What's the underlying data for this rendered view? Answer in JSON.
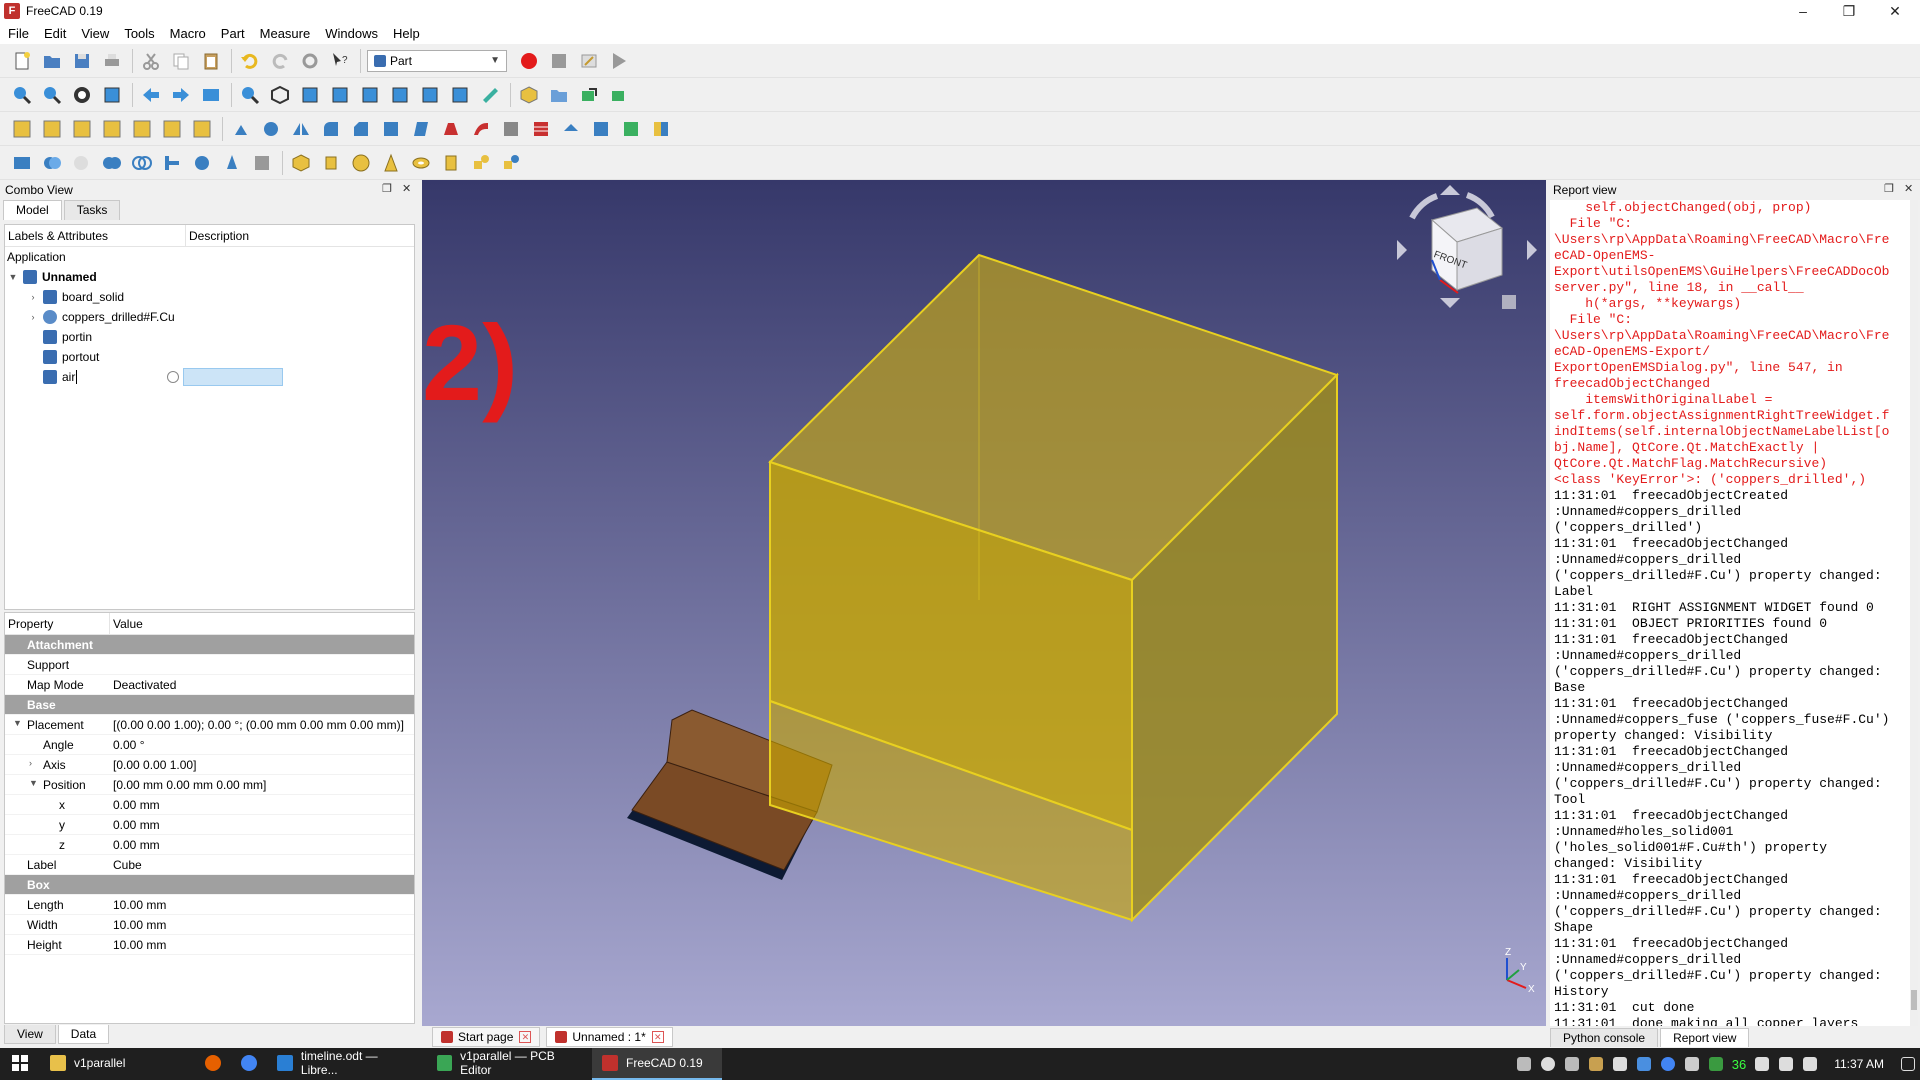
{
  "window": {
    "title": "FreeCAD 0.19",
    "minimize": "–",
    "maximize": "❐",
    "close": "✕"
  },
  "menu": [
    "File",
    "Edit",
    "View",
    "Tools",
    "Macro",
    "Part",
    "Measure",
    "Windows",
    "Help"
  ],
  "toolbar": {
    "workbench": "Part"
  },
  "combo_view": {
    "title": "Combo View",
    "tabs": [
      "Model",
      "Tasks"
    ],
    "tree_headers": [
      "Labels & Attributes",
      "Description"
    ],
    "root_label": "Application",
    "document": "Unnamed",
    "items": [
      {
        "label": "board_solid",
        "expandable": true
      },
      {
        "label": "coppers_drilled#F.Cu",
        "expandable": true
      },
      {
        "label": "portin",
        "expandable": false
      },
      {
        "label": "portout",
        "expandable": false
      },
      {
        "label": "air",
        "expandable": false
      }
    ]
  },
  "properties": {
    "headers": [
      "Property",
      "Value"
    ],
    "rows": [
      {
        "group": "Attachment"
      },
      {
        "name": "Support",
        "value": "",
        "indent": 0
      },
      {
        "name": "Map Mode",
        "value": "Deactivated",
        "indent": 0
      },
      {
        "group": "Base"
      },
      {
        "name": "Placement",
        "value": "[(0.00 0.00 1.00); 0.00 °; (0.00 mm  0.00 mm  0.00 mm)]",
        "indent": 0,
        "expand": "open"
      },
      {
        "name": "Angle",
        "value": "0.00 °",
        "indent": 1
      },
      {
        "name": "Axis",
        "value": "[0.00 0.00 1.00]",
        "indent": 1,
        "expand": "closed"
      },
      {
        "name": "Position",
        "value": "[0.00 mm  0.00 mm  0.00 mm]",
        "indent": 1,
        "expand": "open"
      },
      {
        "name": "x",
        "value": "0.00 mm",
        "indent": 2
      },
      {
        "name": "y",
        "value": "0.00 mm",
        "indent": 2
      },
      {
        "name": "z",
        "value": "0.00 mm",
        "indent": 2
      },
      {
        "name": "Label",
        "value": "Cube",
        "indent": 0
      },
      {
        "group": "Box"
      },
      {
        "name": "Length",
        "value": "10.00 mm",
        "indent": 0
      },
      {
        "name": "Width",
        "value": "10.00 mm",
        "indent": 0
      },
      {
        "name": "Height",
        "value": "10.00 mm",
        "indent": 0
      }
    ],
    "bottom_tabs": [
      "View",
      "Data"
    ]
  },
  "viewport": {
    "annotation": "2)",
    "navcube_face": "FRONT",
    "axis_labels": [
      "Z",
      "Y",
      "X"
    ],
    "box_color": "#c9a700"
  },
  "doc_tabs": [
    "Start page",
    "Unnamed : 1*"
  ],
  "report_view": {
    "title": "Report view",
    "lines": [
      {
        "t": "    self.objectChanged(obj, prop)",
        "err": true
      },
      {
        "t": "  File \"C:",
        "err": true
      },
      {
        "t": "\\Users\\rp\\AppData\\Roaming\\FreeCAD\\Macro\\Fre",
        "err": true
      },
      {
        "t": "eCAD-OpenEMS-",
        "err": true
      },
      {
        "t": "Export\\utilsOpenEMS\\GuiHelpers\\FreeCADDocOb",
        "err": true
      },
      {
        "t": "server.py\", line 18, in __call__",
        "err": true
      },
      {
        "t": "    h(*args, **keywargs)",
        "err": true
      },
      {
        "t": "  File \"C:",
        "err": true
      },
      {
        "t": "\\Users\\rp\\AppData\\Roaming\\FreeCAD\\Macro\\Fre",
        "err": true
      },
      {
        "t": "eCAD-OpenEMS-Export/",
        "err": true
      },
      {
        "t": "ExportOpenEMSDialog.py\", line 547, in",
        "err": true
      },
      {
        "t": "freecadObjectChanged",
        "err": true
      },
      {
        "t": "    itemsWithOriginalLabel =",
        "err": true
      },
      {
        "t": "self.form.objectAssignmentRightTreeWidget.f",
        "err": true
      },
      {
        "t": "indItems(self.internalObjectNameLabelList[o",
        "err": true
      },
      {
        "t": "bj.Name], QtCore.Qt.MatchExactly |",
        "err": true
      },
      {
        "t": "QtCore.Qt.MatchFlag.MatchRecursive)",
        "err": true
      },
      {
        "t": "<class 'KeyError'>: ('coppers_drilled',)",
        "err": true
      },
      {
        "t": "11:31:01  freecadObjectCreated",
        "err": false
      },
      {
        "t": ":Unnamed#coppers_drilled",
        "err": false
      },
      {
        "t": "('coppers_drilled')",
        "err": false
      },
      {
        "t": "11:31:01  freecadObjectChanged",
        "err": false
      },
      {
        "t": ":Unnamed#coppers_drilled",
        "err": false
      },
      {
        "t": "('coppers_drilled#F.Cu') property changed:",
        "err": false
      },
      {
        "t": "Label",
        "err": false
      },
      {
        "t": "11:31:01  RIGHT ASSIGNMENT WIDGET found 0",
        "err": false
      },
      {
        "t": "11:31:01  OBJECT PRIORITIES found 0",
        "err": false
      },
      {
        "t": "11:31:01  freecadObjectChanged",
        "err": false
      },
      {
        "t": ":Unnamed#coppers_drilled",
        "err": false
      },
      {
        "t": "('coppers_drilled#F.Cu') property changed:",
        "err": false
      },
      {
        "t": "Base",
        "err": false
      },
      {
        "t": "11:31:01  freecadObjectChanged",
        "err": false
      },
      {
        "t": ":Unnamed#coppers_fuse ('coppers_fuse#F.Cu')",
        "err": false
      },
      {
        "t": "property changed: Visibility",
        "err": false
      },
      {
        "t": "11:31:01  freecadObjectChanged",
        "err": false
      },
      {
        "t": ":Unnamed#coppers_drilled",
        "err": false
      },
      {
        "t": "('coppers_drilled#F.Cu') property changed:",
        "err": false
      },
      {
        "t": "Tool",
        "err": false
      },
      {
        "t": "11:31:01  freecadObjectChanged",
        "err": false
      },
      {
        "t": ":Unnamed#holes_solid001",
        "err": false
      },
      {
        "t": "('holes_solid001#F.Cu#th') property",
        "err": false
      },
      {
        "t": "changed: Visibility",
        "err": false
      },
      {
        "t": "11:31:01  freecadObjectChanged",
        "err": false
      },
      {
        "t": ":Unnamed#coppers_drilled",
        "err": false
      },
      {
        "t": "('coppers_drilled#F.Cu') property changed:",
        "err": false
      },
      {
        "t": "Shape",
        "err": false
      },
      {
        "t": "11:31:01  freecadObjectChanged",
        "err": false
      },
      {
        "t": ":Unnamed#coppers_drilled",
        "err": false
      },
      {
        "t": "('coppers_drilled#F.Cu') property changed:",
        "err": false
      },
      {
        "t": "History",
        "err": false
      },
      {
        "t": "11:31:01  cut done",
        "err": false
      },
      {
        "t": "11:31:01  done making all copper layers",
        "err": false
      }
    ],
    "bottom_tabs": [
      "Python console",
      "Report view"
    ]
  },
  "taskbar": {
    "apps": [
      {
        "label": "v1parallel",
        "color": "#e8c04a"
      },
      {
        "label": "",
        "color": "#e66000"
      },
      {
        "label": "",
        "color": "#4285f4"
      },
      {
        "label": "timeline.odt — Libre...",
        "color": "#2a7fd4"
      },
      {
        "label": "v1parallel — PCB Editor",
        "color": "#3aa655"
      },
      {
        "label": "FreeCAD 0.19",
        "color": "#c0312d"
      }
    ],
    "tray_number": "36",
    "time": "11:37 AM"
  }
}
